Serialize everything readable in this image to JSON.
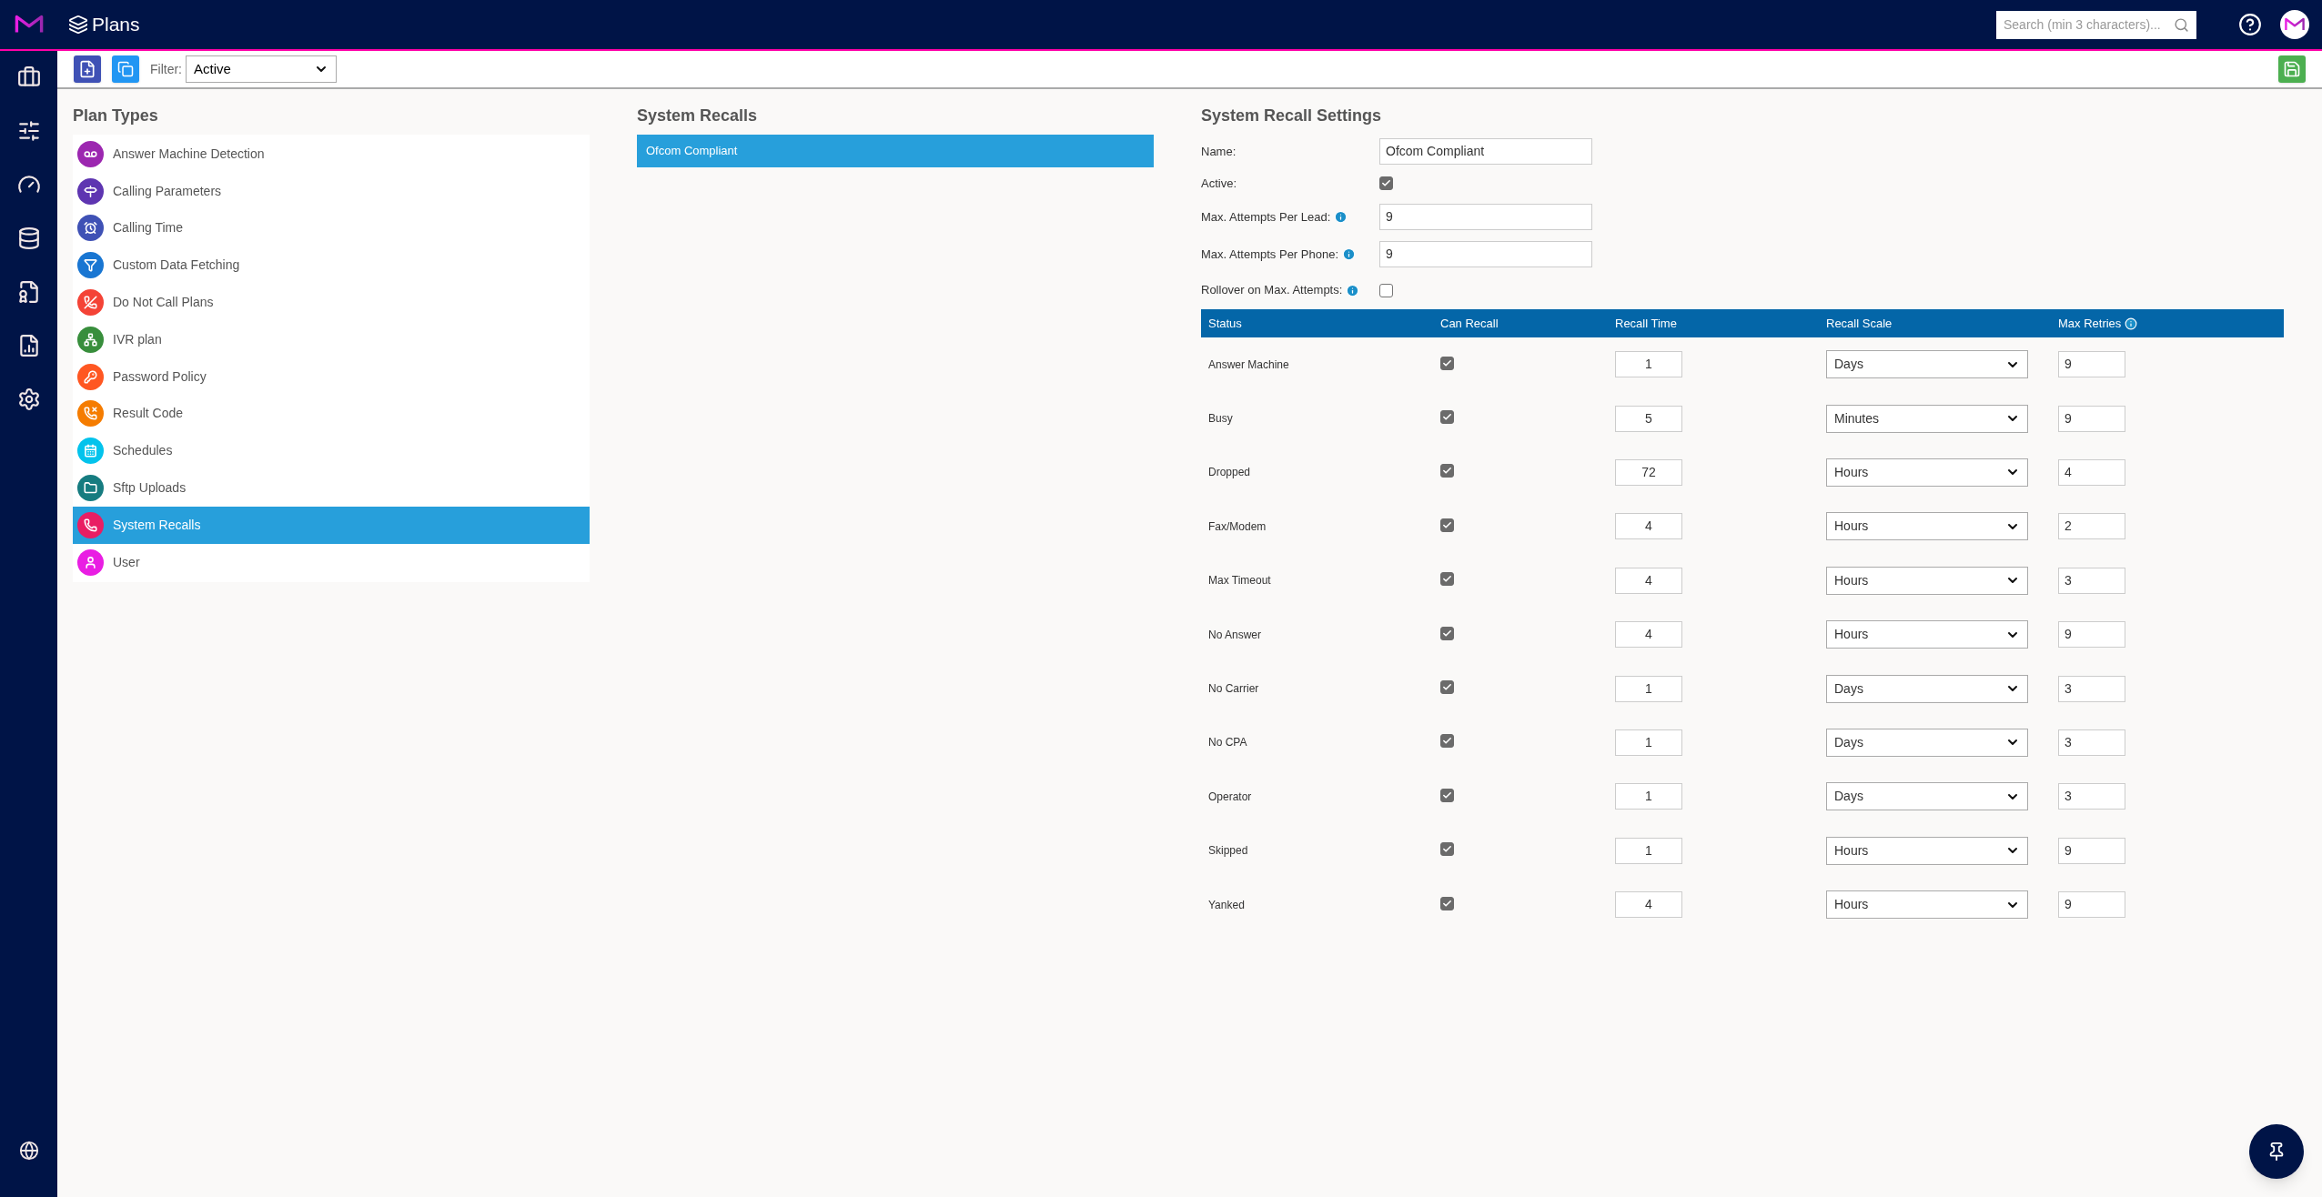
{
  "header": {
    "title": "Plans",
    "search": {
      "placeholder": "Search (min 3 characters)..."
    }
  },
  "toolbar": {
    "filter_label": "Filter:",
    "filter_value": "Active"
  },
  "plan_types": {
    "title": "Plan Types",
    "items": [
      {
        "label": "Answer Machine Detection",
        "color": "#9c27b0",
        "selected": false
      },
      {
        "label": "Calling Parameters",
        "color": "#5e35b1",
        "selected": false
      },
      {
        "label": "Calling Time",
        "color": "#3f51b5",
        "selected": false
      },
      {
        "label": "Custom Data Fetching",
        "color": "#1976d2",
        "selected": false
      },
      {
        "label": "Do Not Call Plans",
        "color": "#f44336",
        "selected": false
      },
      {
        "label": "IVR plan",
        "color": "#388e3c",
        "selected": false
      },
      {
        "label": "Password Policy",
        "color": "#ff5722",
        "selected": false
      },
      {
        "label": "Result Code",
        "color": "#f57c00",
        "selected": false
      },
      {
        "label": "Schedules",
        "color": "#03c3ec",
        "selected": false
      },
      {
        "label": "Sftp Uploads",
        "color": "#167c80",
        "selected": false
      },
      {
        "label": "System Recalls",
        "color": "#e91e63",
        "selected": true
      },
      {
        "label": "User",
        "color": "#e91ee3",
        "selected": false
      }
    ]
  },
  "system_recalls": {
    "title": "System Recalls",
    "items": [
      {
        "label": "Ofcom Compliant",
        "selected": true
      }
    ]
  },
  "settings": {
    "title": "System Recall Settings",
    "name": {
      "label": "Name:",
      "value": "Ofcom Compliant"
    },
    "active": {
      "label": "Active:",
      "checked": true
    },
    "max_attempts_per_lead": {
      "label": "Max. Attempts Per Lead:",
      "value": "9"
    },
    "max_attempts_per_phone": {
      "label": "Max. Attempts Per Phone:",
      "value": "9"
    },
    "rollover": {
      "label": "Rollover on Max. Attempts:",
      "checked": false
    },
    "table": {
      "columns": [
        "Status",
        "Can Recall",
        "Recall Time",
        "Recall Scale",
        "Max Retries"
      ],
      "rows": [
        {
          "status": "Answer Machine",
          "can_recall": true,
          "recall_time": "1",
          "recall_scale": "Days",
          "max_retries": "9"
        },
        {
          "status": "Busy",
          "can_recall": true,
          "recall_time": "5",
          "recall_scale": "Minutes",
          "max_retries": "9"
        },
        {
          "status": "Dropped",
          "can_recall": true,
          "recall_time": "72",
          "recall_scale": "Hours",
          "max_retries": "4"
        },
        {
          "status": "Fax/Modem",
          "can_recall": true,
          "recall_time": "4",
          "recall_scale": "Hours",
          "max_retries": "2"
        },
        {
          "status": "Max Timeout",
          "can_recall": true,
          "recall_time": "4",
          "recall_scale": "Hours",
          "max_retries": "3"
        },
        {
          "status": "No Answer",
          "can_recall": true,
          "recall_time": "4",
          "recall_scale": "Hours",
          "max_retries": "9"
        },
        {
          "status": "No Carrier",
          "can_recall": true,
          "recall_time": "1",
          "recall_scale": "Days",
          "max_retries": "3"
        },
        {
          "status": "No CPA",
          "can_recall": true,
          "recall_time": "1",
          "recall_scale": "Days",
          "max_retries": "3"
        },
        {
          "status": "Operator",
          "can_recall": true,
          "recall_time": "1",
          "recall_scale": "Days",
          "max_retries": "3"
        },
        {
          "status": "Skipped",
          "can_recall": true,
          "recall_time": "1",
          "recall_scale": "Hours",
          "max_retries": "9"
        },
        {
          "status": "Yanked",
          "can_recall": true,
          "recall_time": "4",
          "recall_scale": "Hours",
          "max_retries": "9"
        }
      ]
    }
  }
}
